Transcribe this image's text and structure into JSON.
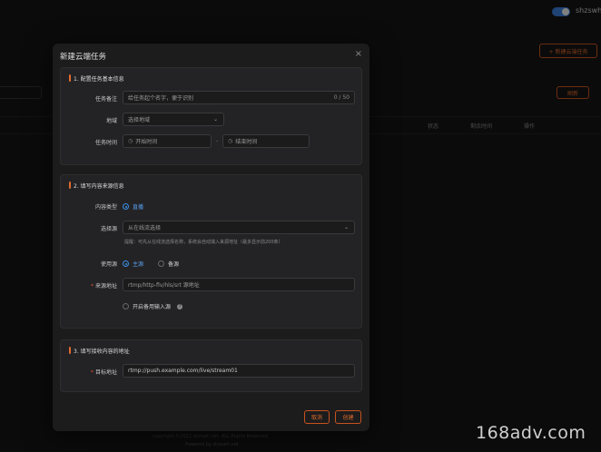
{
  "background": {
    "username": "shzswh",
    "new_task_button": "+ 新建云端任务",
    "refresh_button": "刷新",
    "columns": [
      "状态",
      "剩余时间",
      "操作"
    ],
    "footer_copyright": "copyright ©2022 shzswh.net. ALL Rights Reserved",
    "footer_powered": "Powered by shzswh.net"
  },
  "modal": {
    "title": "新建云端任务",
    "close": "×",
    "section1": {
      "title": "1. 配置任务基本信息",
      "remark_label": "任务备注",
      "remark_placeholder": "给任务起个名字，便于识别",
      "remark_counter": "0 / 50",
      "region_label": "地域",
      "region_placeholder": "选择地域",
      "time_label": "任务时间",
      "start_placeholder": "开始时间",
      "time_separator": "-",
      "end_placeholder": "结束时间"
    },
    "section2": {
      "title": "2. 填写内容来源信息",
      "content_type_label": "内容类型",
      "content_type_option": "直播",
      "source_select_label": "选择源",
      "source_select_placeholder": "从在线流选择",
      "source_hint": "提醒：可先从在线流选择名称，系统会自动填入来源地址（最多显示前200条）",
      "use_source_label": "使用源",
      "primary_option": "主源",
      "backup_option": "备源",
      "source_url_label": "来源地址",
      "source_url_placeholder": "rtmp/http-flv/hls/srt 源地址",
      "enable_backup_label": "开启备用输入源"
    },
    "section3": {
      "title": "3. 填写接收内容的地址",
      "target_label": "目标地址",
      "target_value": "rtmp://push.example.com/live/stream01"
    },
    "cancel_button": "取消",
    "create_button": "创建"
  },
  "watermark": "168adv.com"
}
